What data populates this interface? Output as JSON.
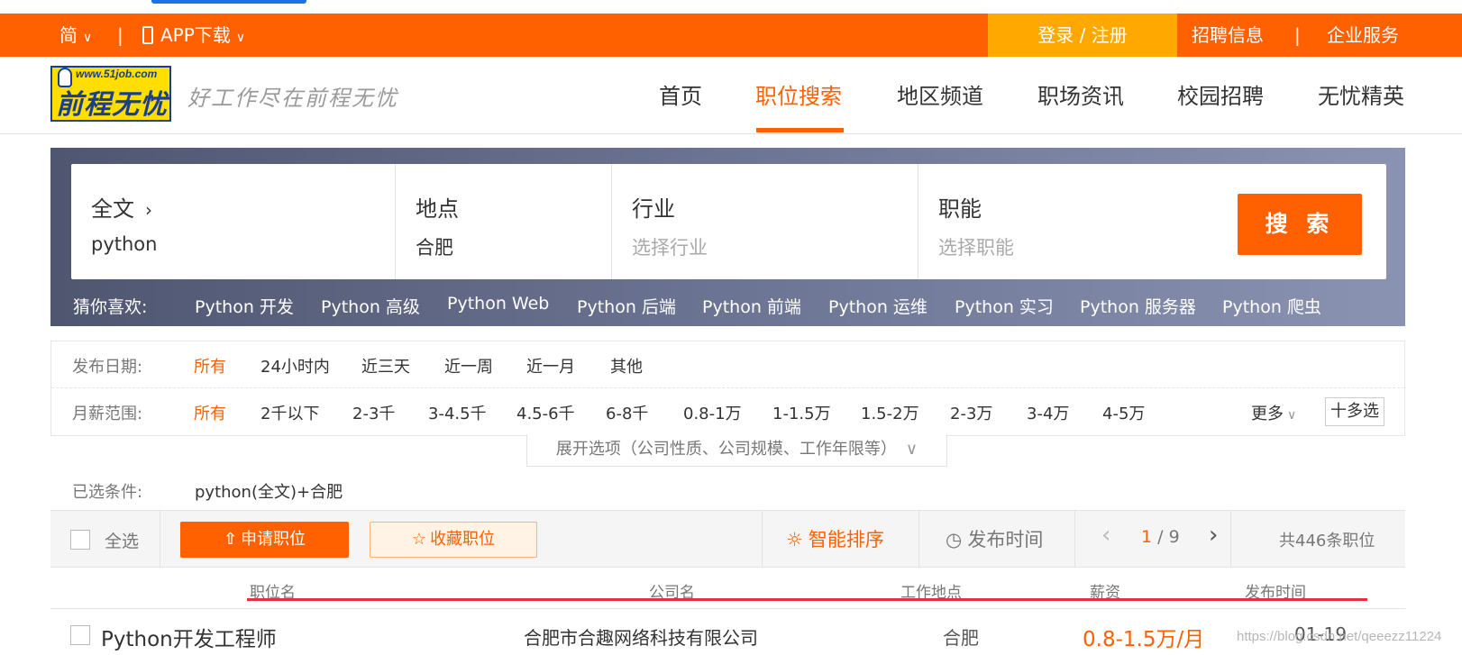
{
  "topbar": {
    "lang_label": "简",
    "app_download_label": "APP下载",
    "login_label": "登录 / 注册",
    "recruit_info_label": "招聘信息",
    "divider": "|",
    "enterprise_service_label": "企业服务"
  },
  "header": {
    "logo_url_text": "www.51job.com",
    "logo_brand_text": "前程无忧",
    "slogan": "好工作尽在前程无忧",
    "nav": [
      {
        "label": "首页"
      },
      {
        "label": "职位搜索",
        "active": true
      },
      {
        "label": "地区频道"
      },
      {
        "label": "职场资讯"
      },
      {
        "label": "校园招聘"
      },
      {
        "label": "无忧精英"
      }
    ]
  },
  "search": {
    "fulltext_label": "全文",
    "fulltext_value": "python",
    "location_label": "地点",
    "location_value": "合肥",
    "industry_label": "行业",
    "industry_placeholder": "选择行业",
    "function_label": "职能",
    "function_placeholder": "选择职能",
    "search_button": "搜 索",
    "guess_label": "猜你喜欢:",
    "guess_items": [
      "Python 开发",
      "Python 高级",
      "Python Web",
      "Python 后端",
      "Python 前端",
      "Python 运维",
      "Python 实习",
      "Python 服务器",
      "Python 爬虫"
    ]
  },
  "filters": {
    "date_label": "发布日期:",
    "date_options": [
      "所有",
      "24小时内",
      "近三天",
      "近一周",
      "近一月",
      "其他"
    ],
    "date_selected": "所有",
    "salary_label": "月薪范围:",
    "salary_options": [
      "所有",
      "2千以下",
      "2-3千",
      "3-4.5千",
      "4.5-6千",
      "6-8千",
      "0.8-1万",
      "1-1.5万",
      "1.5-2万",
      "2-3万",
      "3-4万",
      "4-5万"
    ],
    "salary_selected": "所有",
    "more_label": "更多",
    "multi_label": "十多选",
    "expand_label": "展开选项（公司性质、公司规模、工作年限等）"
  },
  "selected_conditions": {
    "label": "已选条件:",
    "value": "python(全文)+合肥"
  },
  "toolbar": {
    "select_all_label": "全选",
    "apply_label": "申请职位",
    "favorite_label": "收藏职位",
    "smart_sort_label": "智能排序",
    "time_sort_label": "发布时间",
    "page_current": "1",
    "page_sep": "/",
    "page_total": "9",
    "total_label": "共446条职位"
  },
  "columns": [
    "职位名",
    "公司名",
    "工作地点",
    "薪资",
    "发布时间"
  ],
  "jobs": [
    {
      "title": "Python开发工程师",
      "company": "合肥市合趣网络科技有限公司",
      "location": "合肥",
      "salary": "0.8-1.5万/月",
      "date": "01-19"
    }
  ],
  "watermark": "https://blog.csdn.net/qeeezz11224",
  "colors": {
    "brand_orange": "#ff6000",
    "login_bg": "#ffa800",
    "logo_yellow": "#ffde00",
    "logo_blue": "#1b3f8f",
    "underline_red": "#e8303c"
  }
}
